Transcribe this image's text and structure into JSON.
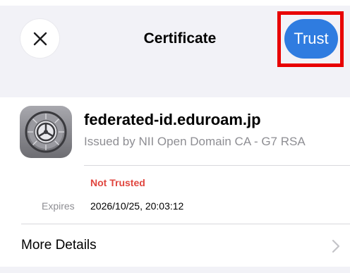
{
  "header": {
    "title": "Certificate",
    "close_icon": "close-icon",
    "trust_label": "Trust",
    "highlight_color": "#e80000",
    "button_color": "#2f7ce0"
  },
  "certificate": {
    "icon": "settings-gear-icon",
    "domain": "federated-id.eduroam.jp",
    "issuer": "Issued by NII Open Domain CA - G7 RSA",
    "status": "Not Trusted",
    "status_color": "#e0463f",
    "expires_label": "Expires",
    "expires_value": "2026/10/25, 20:03:12"
  },
  "more_details": {
    "label": "More Details",
    "icon": "chevron-right-icon"
  }
}
